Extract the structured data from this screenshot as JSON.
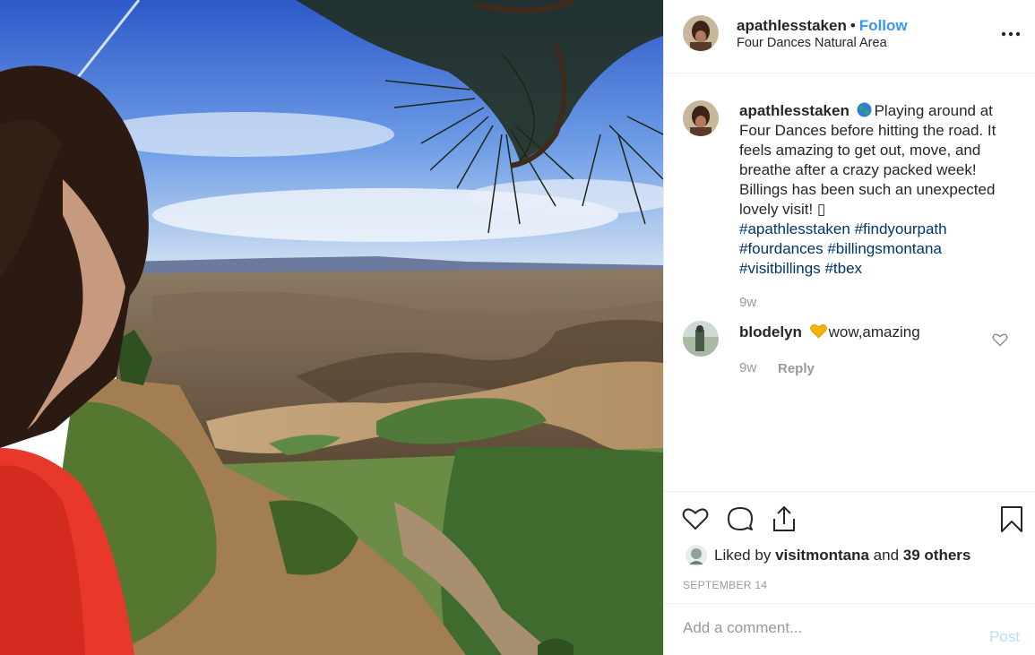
{
  "post": {
    "username": "apathlesstaken",
    "follow_label": "Follow",
    "location": "Four Dances Natural Area",
    "dot": "•"
  },
  "caption": {
    "username": "apathlesstaken",
    "text": "Playing around at Four Dances before hitting the road. It feels amazing to get out, move, and breathe after a crazy packed week! Billings has been such an unexpected lovely visit! ",
    "end_glyph": "▯",
    "hashtags": [
      "#apathlesstaken",
      "#findyourpath",
      "#fourdances",
      "#billingsmontana",
      "#visitbillings",
      "#tbex"
    ],
    "time": "9w"
  },
  "comments": [
    {
      "username": "blodelyn",
      "text": "wow,amazing",
      "time": "9w",
      "reply_label": "Reply"
    }
  ],
  "likes": {
    "prefix": "Liked by",
    "first_user": "visitmontana",
    "and": "and",
    "others": "39 others"
  },
  "date": "SEPTEMBER 14",
  "add_comment": {
    "placeholder": "Add a comment...",
    "post_label": "Post"
  },
  "icons": {
    "more": "more-options-icon",
    "like": "heart-icon",
    "comment": "comment-bubble-icon",
    "share": "share-icon",
    "save": "bookmark-icon",
    "globe": "globe-emoji-icon",
    "yellow_heart": "yellow-heart-emoji-icon",
    "comment_like": "small-heart-icon"
  },
  "colors": {
    "link": "#3897f0",
    "hashtag": "#003569",
    "muted": "#999999",
    "post_disabled": "#b2dffc"
  }
}
